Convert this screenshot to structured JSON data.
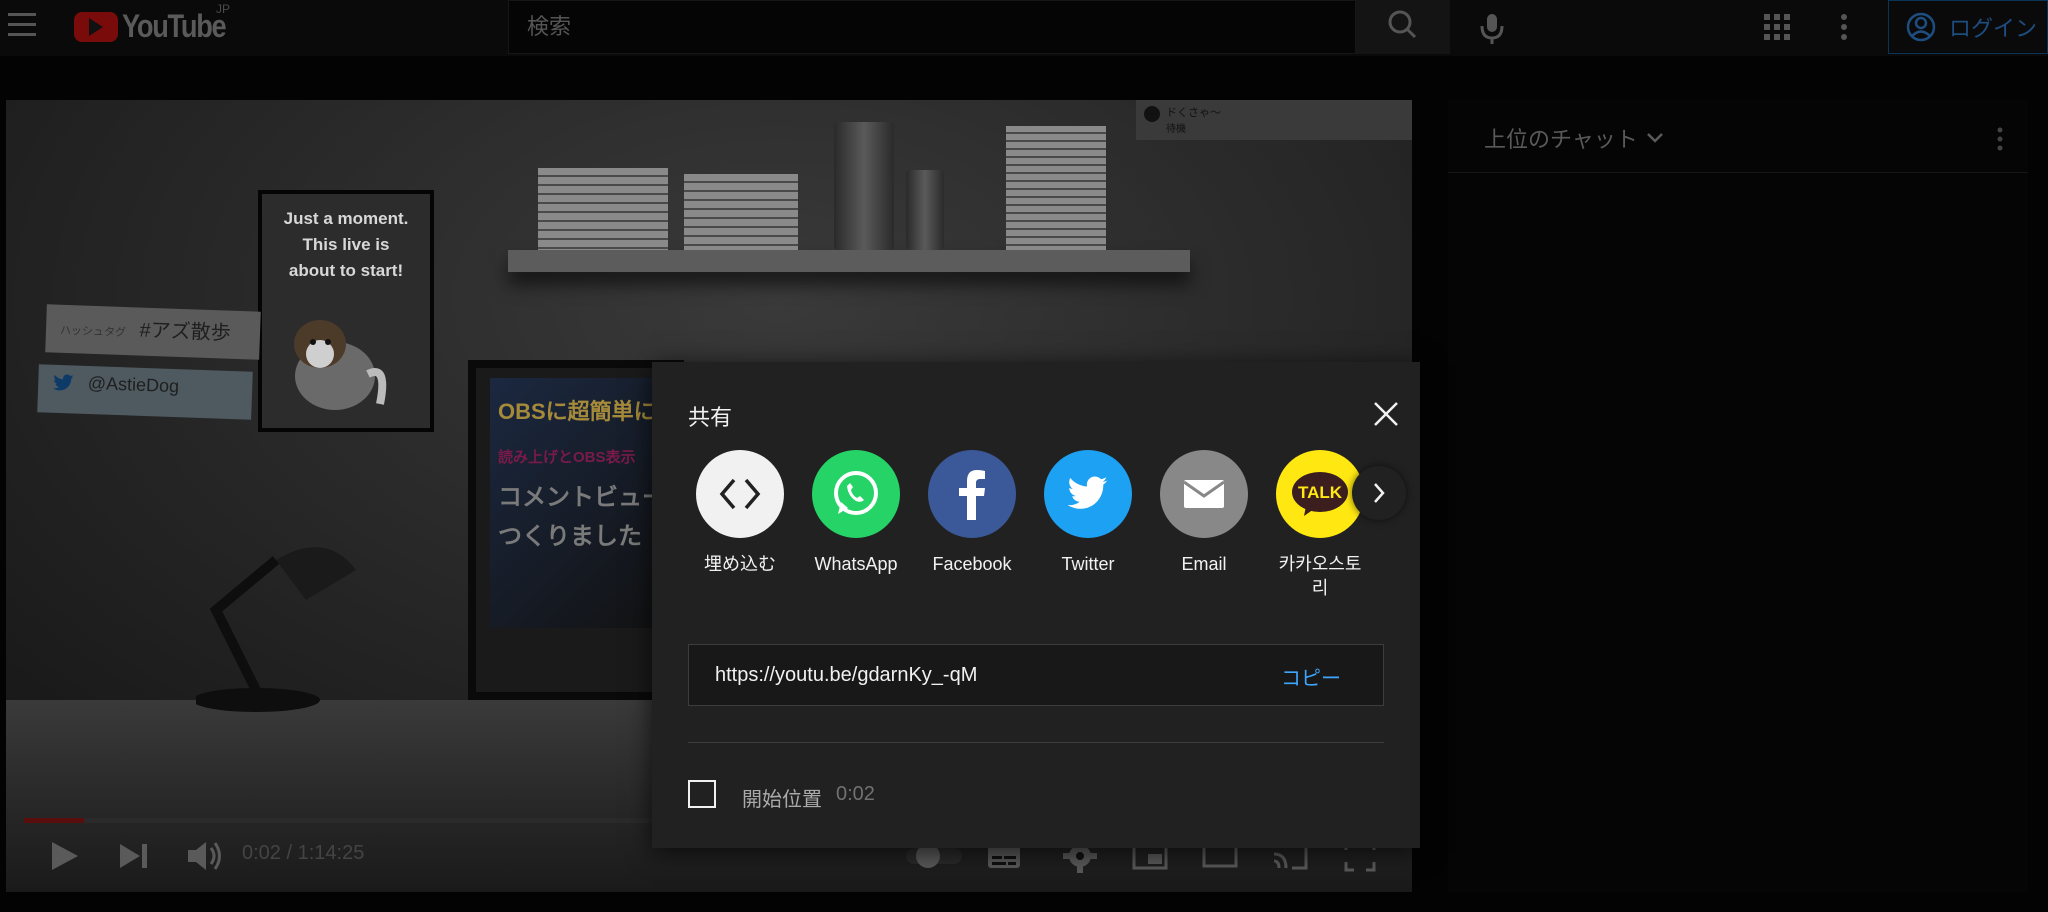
{
  "header": {
    "logo_text": "YouTube",
    "region_tag": "JP",
    "search_placeholder": "検索",
    "login_label": "ログイン"
  },
  "player": {
    "poster_text": "Just a moment.\nThis live is\nabout to start!",
    "note_hashtag_small": "ハッシュタグ",
    "note_hashtag": "#アズ散歩",
    "note_twitter_handle": "@AstieDog",
    "monitor_line1": "OBSに超簡単に",
    "monitor_line2": "読み上げとOBS表示",
    "monitor_line3": "コメントビュー",
    "monitor_line4": "つくりました",
    "chat_badge_name": "ドくさゃ〜",
    "chat_badge_sub": "待機",
    "time_display": "0:02 / 1:14:25",
    "progress_fraction": 0.0
  },
  "chat": {
    "title": "上位のチャット"
  },
  "share": {
    "title": "共有",
    "items": [
      {
        "label": "埋め込む",
        "icon": "embed-icon",
        "color": "#f1f1f1"
      },
      {
        "label": "WhatsApp",
        "icon": "whatsapp-icon",
        "color": "#25d366"
      },
      {
        "label": "Facebook",
        "icon": "facebook-icon",
        "color": "#3b5998"
      },
      {
        "label": "Twitter",
        "icon": "twitter-icon",
        "color": "#1da1f2"
      },
      {
        "label": "Email",
        "icon": "email-icon",
        "color": "#888888"
      },
      {
        "label": "카카오스토\n리",
        "icon": "kakaotalk-icon",
        "color": "#ffe812"
      }
    ],
    "kakao_icon_text": "TALK",
    "url": "https://youtu.be/gdarnKy_-qM",
    "copy_label": "コピー",
    "start_label": "開始位置",
    "start_time": "0:02"
  },
  "colors": {
    "accent": "#3ea6ff",
    "dialog_bg": "#212121"
  }
}
